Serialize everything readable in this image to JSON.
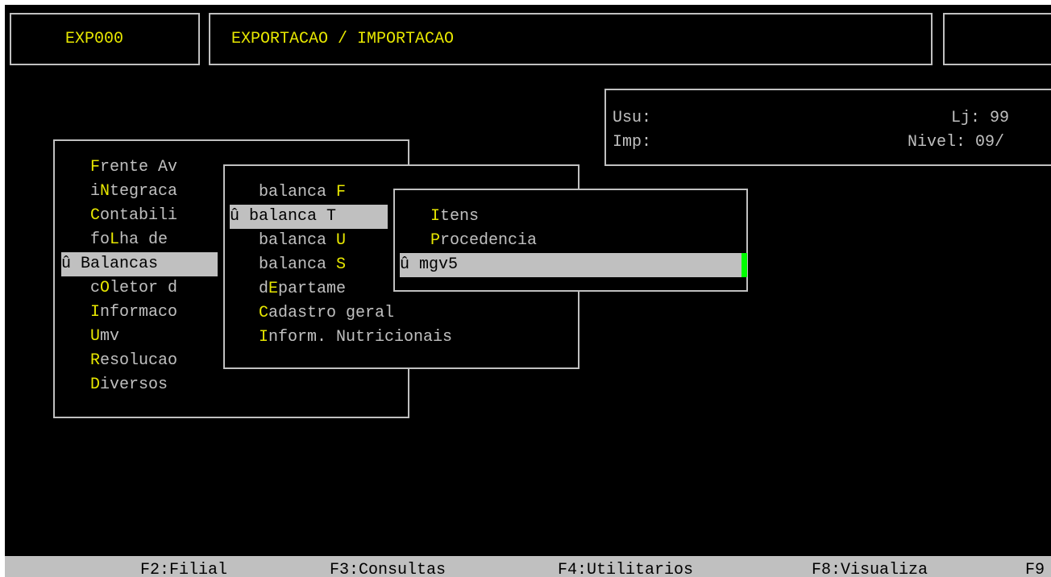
{
  "header": {
    "code": "EXP000",
    "title": "EXPORTACAO / IMPORTACAO"
  },
  "info": {
    "usu_label": "Usu:",
    "imp_label": "Imp:",
    "lj": "Lj: 99",
    "nivel": "Nivel: 09/"
  },
  "menu1": [
    {
      "pre": "",
      "key": "F",
      "post": "rente Av"
    },
    {
      "pre": "i",
      "key": "N",
      "post": "tegraca"
    },
    {
      "pre": "",
      "key": "C",
      "post": "ontabili"
    },
    {
      "pre": "fo",
      "key": "L",
      "post": "ha de"
    },
    {
      "selected": true,
      "text": "û Balancas"
    },
    {
      "pre": "c",
      "key": "O",
      "post": "letor d"
    },
    {
      "pre": "",
      "key": "I",
      "post": "nformaco"
    },
    {
      "pre": "",
      "key": "U",
      "post": "mv"
    },
    {
      "pre": "",
      "key": "R",
      "post": "esolucao"
    },
    {
      "pre": "",
      "key": "D",
      "post": "iversos"
    }
  ],
  "menu2": [
    {
      "pre": "balanca ",
      "key": "F",
      "post": ""
    },
    {
      "selected": true,
      "text": "û balanca T"
    },
    {
      "pre": "balanca ",
      "key": "U",
      "post": ""
    },
    {
      "pre": "balanca ",
      "key": "S",
      "post": ""
    },
    {
      "pre": "d",
      "key": "E",
      "post": "partame"
    },
    {
      "pre": "",
      "key": "C",
      "post": "adastro geral"
    },
    {
      "pre": "",
      "key": "I",
      "post": "nform. Nutricionais"
    }
  ],
  "menu3": [
    {
      "pre": "",
      "key": "I",
      "post": "tens"
    },
    {
      "pre": "",
      "key": "P",
      "post": "rocedencia"
    },
    {
      "selected": true,
      "text": "û mgv5"
    }
  ],
  "function_keys": [
    "F2:Filial",
    "F3:Consultas",
    "F4:Utilitarios",
    "F8:Visualiza",
    "F9"
  ],
  "colors": {
    "background": "#000000",
    "text": "#c0c0c0",
    "hotkey": "#e8e800",
    "highlight": "#c0c0c0",
    "cursor": "#00ff00"
  }
}
